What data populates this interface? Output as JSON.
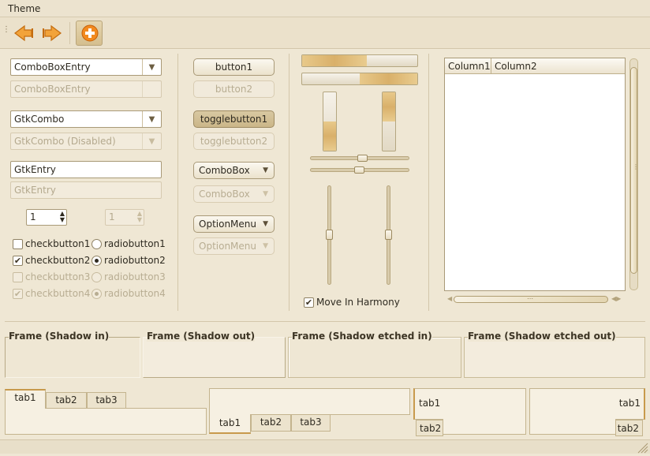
{
  "menu": {
    "theme": "Theme"
  },
  "toolbar": {
    "back_icon": "arrow-left-icon",
    "forward_icon": "arrow-right-icon",
    "add_icon": "add-icon"
  },
  "col1": {
    "comboentry1": "ComboBoxEntry",
    "comboentry2": "ComboBoxEntry",
    "gtkcombo1": "GtkCombo",
    "gtkcombo2": "GtkCombo (Disabled)",
    "entry1": "GtkEntry",
    "entry2": "GtkEntry",
    "spin1": "1",
    "spin2": "1",
    "checks": [
      "checkbutton1",
      "checkbutton2",
      "checkbutton3",
      "checkbutton4"
    ],
    "radios": [
      "radiobutton1",
      "radiobutton2",
      "radiobutton3",
      "radiobutton4"
    ]
  },
  "col2": {
    "button1": "button1",
    "button2": "button2",
    "toggle1": "togglebutton1",
    "toggle2": "togglebutton2",
    "combobox1": "ComboBox",
    "combobox2": "ComboBox",
    "option1": "OptionMenu",
    "option2": "OptionMenu"
  },
  "col3": {
    "harmony": "Move In Harmony"
  },
  "progress": {
    "h1": 0.56,
    "h2": 0.5,
    "v1": 0.5,
    "v2": 0.5
  },
  "tree": {
    "col1": "Column1",
    "col2": "Column2"
  },
  "frames": [
    "Frame (Shadow in)",
    "Frame (Shadow out)",
    "Frame (Shadow etched in)",
    "Frame (Shadow etched out)"
  ],
  "tabs": {
    "top": [
      "tab1",
      "tab2",
      "tab3"
    ],
    "bottom": [
      "tab1",
      "tab2",
      "tab3"
    ],
    "left": [
      "tab1",
      "tab2"
    ],
    "right": [
      "tab1",
      "tab2"
    ]
  },
  "colors": {
    "accent": "#e08a1e",
    "background": "#efe7d4",
    "progress_fill": "#d9b06a"
  }
}
